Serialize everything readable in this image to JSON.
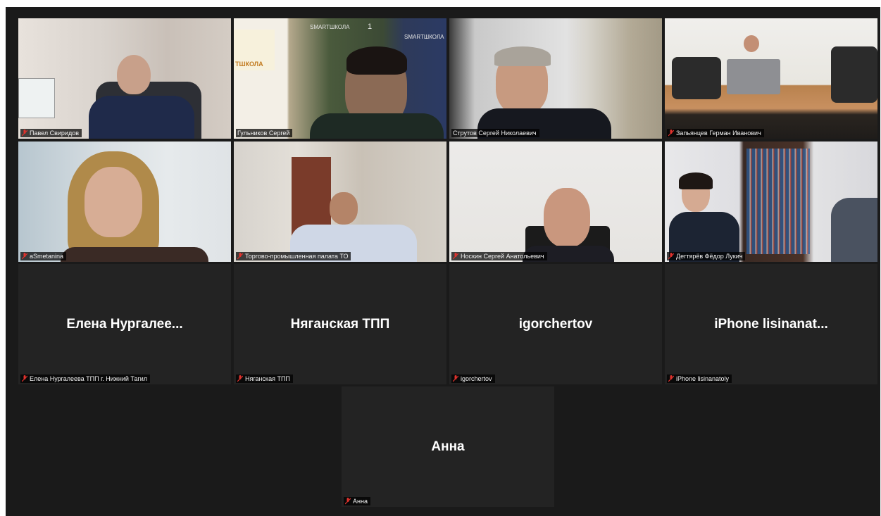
{
  "participants": [
    {
      "name": "Павел Свиридов",
      "video": true
    },
    {
      "name": "Гульников Сергей",
      "video": true
    },
    {
      "name": "Струтов Сергей Николаевич",
      "video": true,
      "active_speaker": true
    },
    {
      "name": "Запьянцев Герман Иванович",
      "video": true
    },
    {
      "name": "aSmetanina",
      "video": true
    },
    {
      "name": "Торгово-промышленная палата ТО",
      "video": true
    },
    {
      "name": "Носкин Сергей Анатольевич",
      "video": true
    },
    {
      "name": "Дегтярёв Фёдор Лукич",
      "video": true
    },
    {
      "name": "Елена Нургалеева ТПП г. Нижний Тагил",
      "display_name": "Елена  Нургалее...",
      "video": false
    },
    {
      "name": "Няганская ТПП",
      "display_name": "Няганская ТПП",
      "video": false
    },
    {
      "name": "igorchertov",
      "display_name": "igorchertov",
      "video": false
    },
    {
      "name": "iPhone lisinanatoly",
      "display_name": "iPhone  lisinanat...",
      "video": false
    },
    {
      "name": "Анна",
      "display_name": "Анна",
      "video": false
    }
  ],
  "banner_text": {
    "logo1": "ТШКОЛА",
    "logo2": "SMARTШКОЛА",
    "logo3": "SMARTШКОЛА",
    "panel_num": "1"
  },
  "colors": {
    "background": "#1a1a1a",
    "tile": "#232323",
    "active_border": "#c9d86a",
    "muted_mic": "#e0322d"
  }
}
